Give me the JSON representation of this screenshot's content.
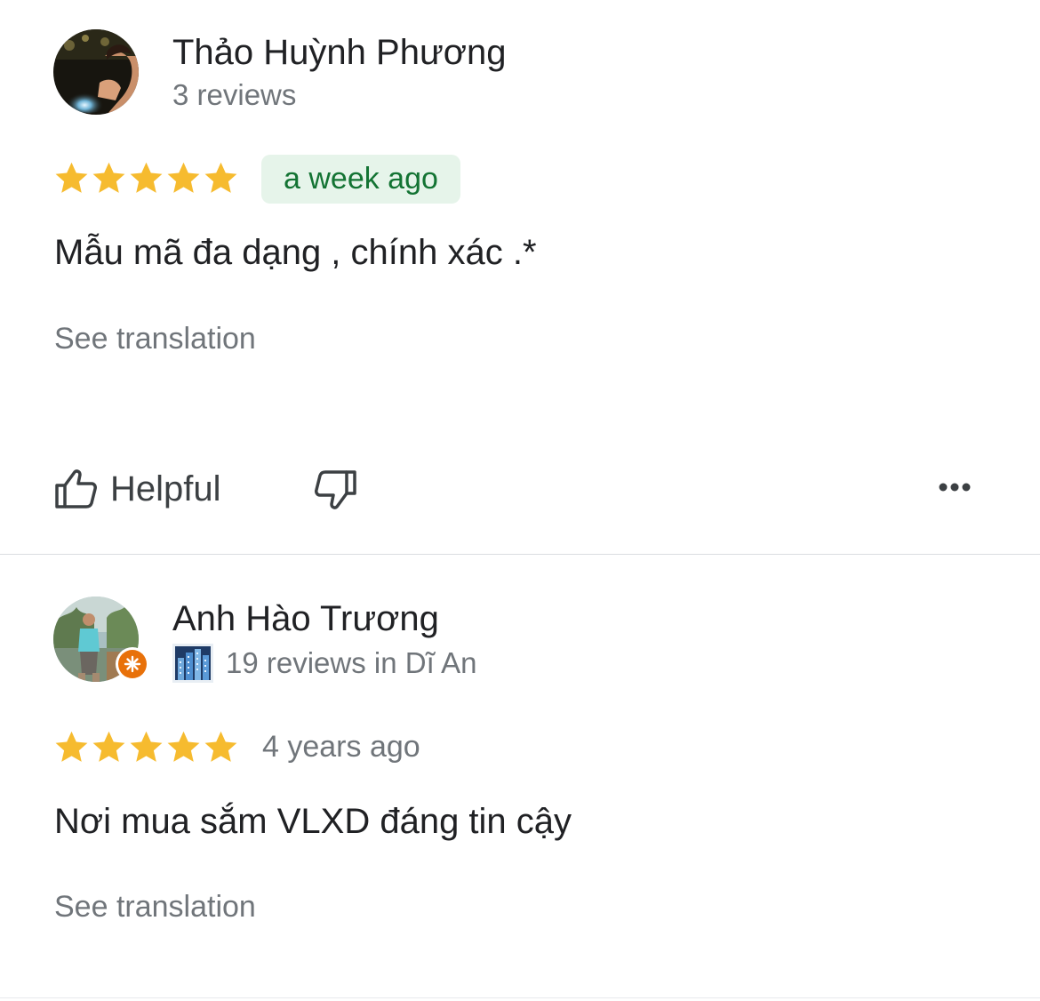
{
  "reviews": [
    {
      "author": "Thảo Huỳnh Phương",
      "meta": "3 reviews",
      "rating": 5,
      "date": "a week ago",
      "text": "Mẫu mã đa dạng , chính xác .*",
      "see_translation": "See translation",
      "helpful_label": "Helpful",
      "local_guide": false
    },
    {
      "author": "Anh Hào Trương",
      "meta": "19 reviews in Dĩ An",
      "rating": 5,
      "date": "4 years ago",
      "text": "Nơi mua sắm VLXD đáng tin cậy",
      "see_translation": "See translation",
      "local_guide": true
    }
  ],
  "colors": {
    "star": "#f6bb2f",
    "date_pill_bg": "#e6f4ea",
    "date_pill_text": "#137333",
    "local_guide_badge": "#e8710a",
    "secondary_text": "#70757a"
  },
  "icons": {
    "rating": "star-icon",
    "helpful": "thumbs-up-icon",
    "not_helpful": "thumbs-down-icon",
    "more": "more-horizontal-icon",
    "local_guide": "local-guide-badge-icon",
    "city": "city-skyline-icon"
  }
}
